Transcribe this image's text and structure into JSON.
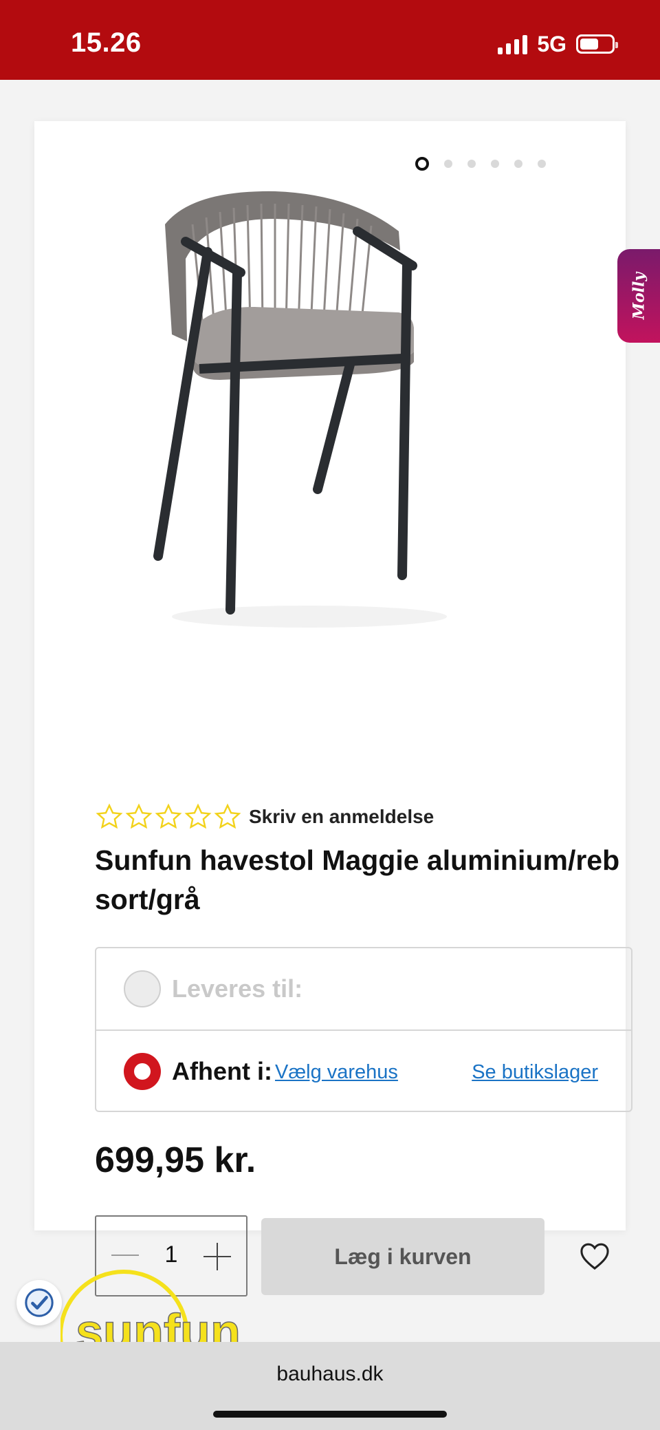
{
  "status_bar": {
    "time": "15.26",
    "network": "5G",
    "battery_level": 0.6,
    "signal_bars": 4
  },
  "gallery": {
    "image_count": 6,
    "active_index": 0,
    "image_icon": "garden-chair-image"
  },
  "chat_tab": {
    "label": "Molly"
  },
  "product": {
    "rating": {
      "stars": 0,
      "max": 5,
      "review_link": "Skriv en anmeldelse"
    },
    "title": "Sunfun havestol Maggie aluminium/reb sort/grå",
    "price": "699,95 kr."
  },
  "delivery": {
    "ship_label": "Leveres til:",
    "pickup_label": "Afhent i:",
    "choose_store": "Vælg varehus",
    "store_stock": "Se butikslager",
    "selected": "pickup"
  },
  "cart": {
    "quantity": "1",
    "add_label": "Læg i kurven"
  },
  "brand": {
    "logo_text": "sunfun"
  },
  "browser": {
    "url": "bauhaus.dk"
  },
  "colors": {
    "brand_red": "#b30b0f",
    "link_blue": "#1a73c5",
    "star_yellow": "#f2d21b"
  }
}
